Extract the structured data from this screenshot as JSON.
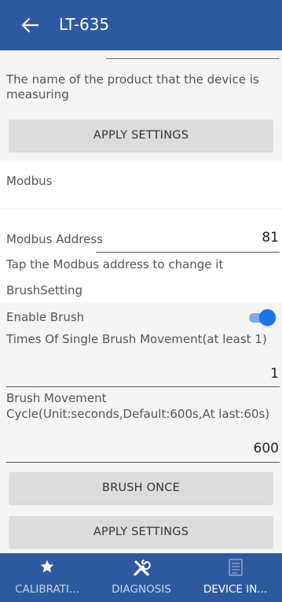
{
  "appbar": {
    "title": "LT-635"
  },
  "product": {
    "description": "The name of the product that the device is measuring",
    "apply_label": "APPLY SETTINGS"
  },
  "modbus": {
    "section_title": "Modbus",
    "address_label": "Modbus Address",
    "address_value": "81",
    "hint": "Tap the Modbus address to change it"
  },
  "brush": {
    "section_title": "BrushSetting",
    "enable_label": "Enable Brush",
    "enable_on": true,
    "times_label": "Times Of Single Brush Movement(at least 1)",
    "times_value": "1",
    "cycle_label_line1": "Brush Movement",
    "cycle_label_line2": "Cycle(Unit:seconds,Default:600s,At last:60s)",
    "cycle_value": "600",
    "brush_once_label": "BRUSH ONCE",
    "apply_label": "APPLY SETTINGS"
  },
  "colors": {
    "appbar": "#2f5aa0",
    "toggle_on": "#1a73e8",
    "button_bg": "#dcdcdc"
  },
  "bottom_nav": [
    {
      "label": "CALIBRATI...",
      "icon": "star-icon"
    },
    {
      "label": "DIAGNOSIS",
      "icon": "tools-icon"
    },
    {
      "label": "DEVICE IN...",
      "icon": "document-icon",
      "active": true
    }
  ]
}
